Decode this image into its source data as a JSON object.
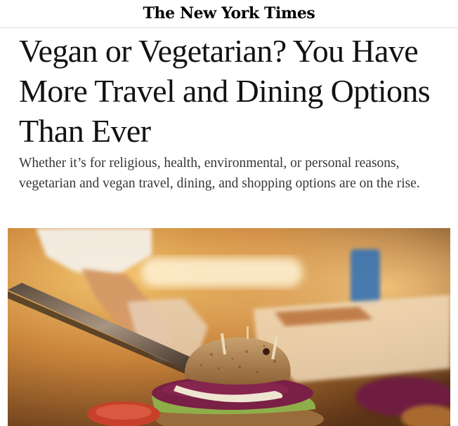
{
  "masthead": {
    "logo_text": "The New York Times"
  },
  "article": {
    "headline": "Vegan or Vegetarian? You Have More Travel and Dining Options Than Ever",
    "summary": "Whether it’s for religious, health, environmental, or personal reasons, vegetarian and vegan travel, dining, and shopping options are on the rise."
  },
  "hero_image": {
    "subject": "veggie burger being cut with a knife",
    "colors": {
      "background_warm": "#c98a3c",
      "bun": "#b88a57",
      "patty": "#7a1f45",
      "lettuce": "#8fae4a",
      "tomato": "#c8402a"
    }
  }
}
